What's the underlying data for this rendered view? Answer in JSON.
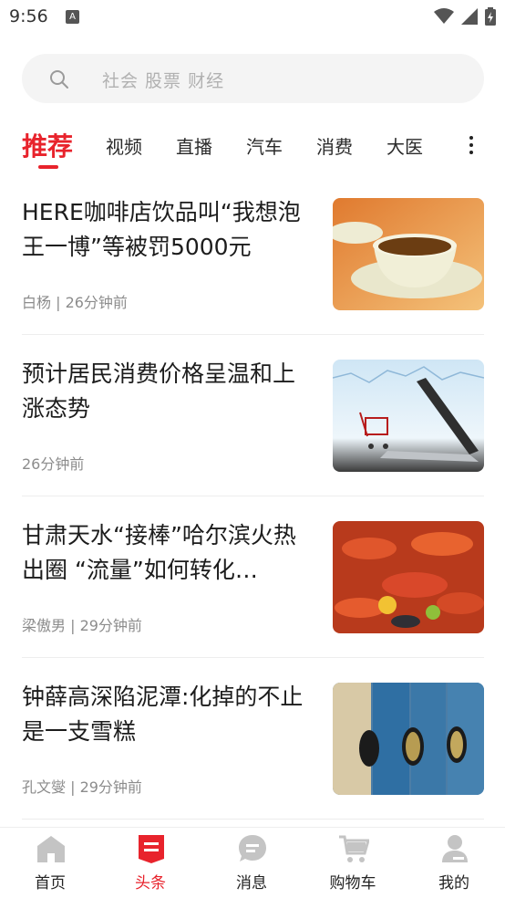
{
  "status_bar": {
    "time": "9:56",
    "notification_icon": "A"
  },
  "search": {
    "placeholder": "社会 股票 财经"
  },
  "tabs": [
    {
      "label": "推荐",
      "active": true
    },
    {
      "label": "视频"
    },
    {
      "label": "直播"
    },
    {
      "label": "汽车"
    },
    {
      "label": "消费"
    },
    {
      "label": "大医"
    }
  ],
  "news": [
    {
      "title": "HERE咖啡店饮品叫“我想泡王一博”等被罚5000元",
      "meta": "白杨 | 26分钟前",
      "thumb": "tea-cup-image"
    },
    {
      "title": "预计居民消费价格呈温和上涨态势",
      "meta": "26分钟前",
      "thumb": "shopping-cart-laptop-image"
    },
    {
      "title": "甘肃天水“接棒”哈尔滨火热出圈 “流量”如何转化…",
      "meta": "梁傲男 | 29分钟前",
      "thumb": "seafood-platter-image"
    },
    {
      "title": "钟薛高深陷泥潭:化掉的不止是一支雪糕",
      "meta": "孔文燮 | 29分钟前",
      "thumb": "blue-binders-image"
    }
  ],
  "bottom_nav": [
    {
      "label": "首页",
      "icon": "home-icon"
    },
    {
      "label": "头条",
      "icon": "headline-icon",
      "active": true
    },
    {
      "label": "消息",
      "icon": "message-icon"
    },
    {
      "label": "购物车",
      "icon": "cart-icon"
    },
    {
      "label": "我的",
      "icon": "profile-icon"
    }
  ],
  "colors": {
    "accent": "#e8232c",
    "icon_gray": "#c4c4c4"
  }
}
